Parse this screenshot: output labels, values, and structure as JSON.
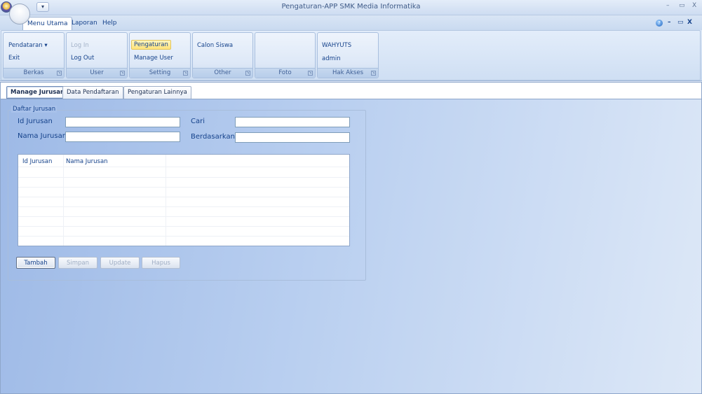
{
  "window": {
    "title": "Pengaturan-APP SMK Media Informatika",
    "controls": {
      "minimize": "–",
      "restore": "▭",
      "close": "X"
    },
    "qat_glyph": "▾"
  },
  "menu": {
    "tabs": [
      "Menu Utama",
      "Laporan",
      "Help"
    ],
    "mdi_controls": {
      "minimize": "–",
      "restore": "▭",
      "close": "X"
    }
  },
  "ribbon": {
    "groups": [
      {
        "label": "Berkas",
        "items": [
          "Pendataran ▾",
          "Exit"
        ]
      },
      {
        "label": "User",
        "items": [
          "Log In",
          "Log Out"
        ]
      },
      {
        "label": "Setting",
        "items": [
          "Pengaturan",
          "Manage User"
        ]
      },
      {
        "label": "Other",
        "items": [
          "Calon Siswa"
        ]
      },
      {
        "label": "Foto",
        "items": []
      },
      {
        "label": "Hak Akses",
        "items": [
          "WAHYUTS",
          "admin"
        ]
      }
    ]
  },
  "doc_tabs": [
    "Manage Jurusan",
    "Data Pendaftaran",
    "Pengaturan Lainnya"
  ],
  "form": {
    "legend": "Daftar Jurusan",
    "id_label": "Id Jurusan",
    "id_value": "",
    "nama_label": "Nama Jurusan",
    "nama_value": "",
    "cari_label": "Cari",
    "cari_value": "",
    "berdasarkan_label": "Berdasarkan",
    "berdasarkan_value": ""
  },
  "grid": {
    "columns": [
      "Id Jurusan",
      "Nama Jurusan"
    ],
    "rows": []
  },
  "buttons": {
    "tambah": "Tambah",
    "simpan": "Simpan",
    "update": "Update",
    "hapus": "Hapus"
  },
  "colors": {
    "accent": "#15428b",
    "ribbon_highlight": "#ffe37a",
    "content_bg_start": "#9db9e6",
    "content_bg_end": "#dde8f7"
  }
}
